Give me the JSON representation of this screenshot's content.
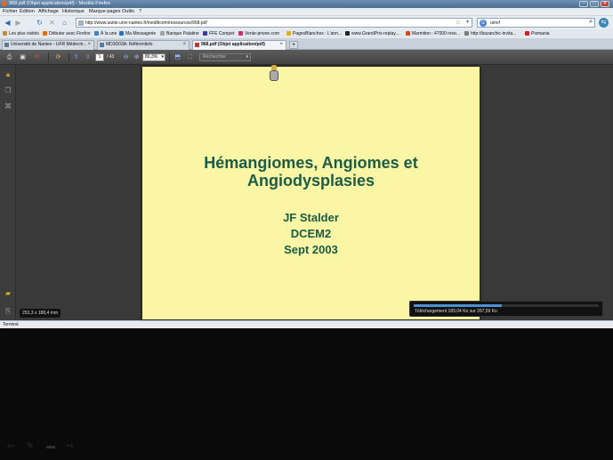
{
  "window": {
    "title": "968.pdf (Objet application/pdf) - Mozilla Firefox",
    "controls": [
      "–",
      "▢",
      "✕"
    ]
  },
  "menu": [
    "Fichier",
    "Édition",
    "Affichage",
    "Historique",
    "Marque-pages",
    "Outils",
    "?"
  ],
  "nav": {
    "url": "http://www.sante.univ-nantes.fr/med/ticem/ressources/968.pdf",
    "search_value": "umvf"
  },
  "bookmarks": [
    {
      "label": "Les plus visités",
      "color": "#c98c2a"
    },
    {
      "label": "Débuter avec Firefox",
      "color": "#e66b17"
    },
    {
      "label": "À la une",
      "color": "#4a7fc0"
    },
    {
      "label": "Ma Messagerie",
      "color": "#2a6fb8"
    },
    {
      "label": "Banque Palatine",
      "color": "#a0a0a0"
    },
    {
      "label": "FFE Compet",
      "color": "#3b3b8f"
    },
    {
      "label": "Vente-privee.com",
      "color": "#c4376b"
    },
    {
      "label": "PagesBlanches : L'ann...",
      "color": "#d9b21a"
    },
    {
      "label": "www.GrandPrix-replay....",
      "color": "#222222"
    },
    {
      "label": "Marmiton : 47000 rece...",
      "color": "#d34a1b"
    },
    {
      "label": "http://bazarchic-invita...",
      "color": "#7a7a7a"
    },
    {
      "label": "Pixmania",
      "color": "#cc2222"
    }
  ],
  "tabs": [
    {
      "label": "Université de Nantes - UFR Médecin...",
      "active": false
    },
    {
      "label": "MD3D03A: Référentiels",
      "active": false
    },
    {
      "label": "968.pdf (Objet application/pdf)",
      "active": true
    }
  ],
  "pdf_toolbar": {
    "page": "1",
    "page_count": "/ 43",
    "zoom": "80,3%",
    "find_placeholder": "Rechercher"
  },
  "slide": {
    "title_line1": "Hémangiomes, Angiomes et",
    "title_line2": "Angiodysplasies",
    "author": "JF Stalder",
    "course": "DCEM2",
    "date": "Sept 2003",
    "bg_color": "#fbf6a6",
    "text_color": "#1a5c45"
  },
  "page_dims": "253,3 x 188,4 mm",
  "download": {
    "label": "Téléchargement 189,04 Ko sur 397,59 Ko",
    "progress": 0.475
  },
  "status": "Terminé"
}
